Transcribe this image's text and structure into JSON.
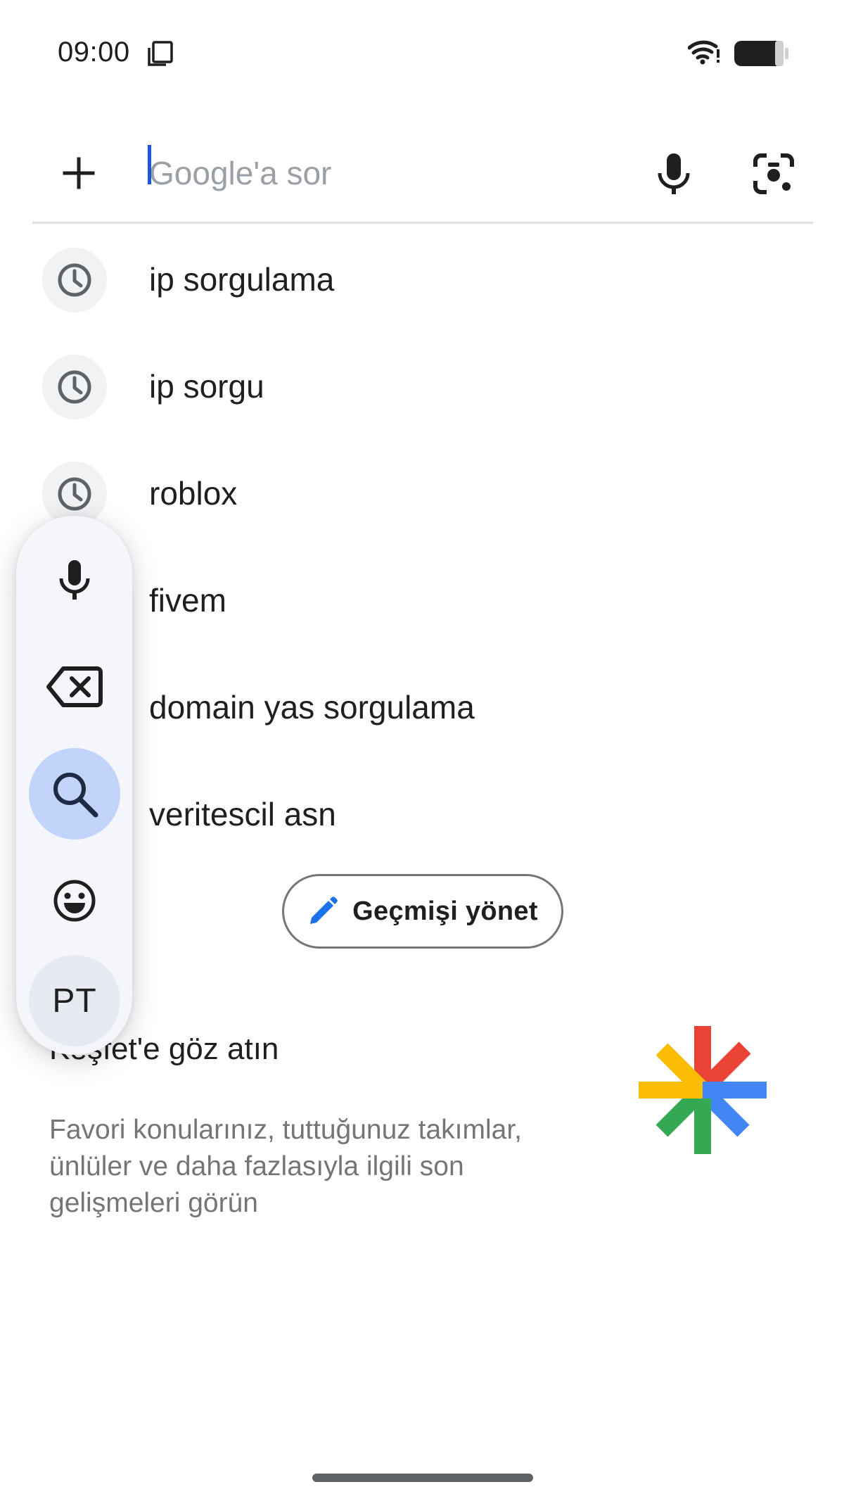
{
  "status_bar": {
    "time": "09:00",
    "icons": [
      "copy-icon",
      "wifi-icon",
      "battery-icon"
    ]
  },
  "search": {
    "placeholder": "Google'a sor",
    "value": "",
    "icons": [
      "plus-icon",
      "mic-icon",
      "lens-icon"
    ]
  },
  "suggestions": [
    {
      "text": "ip sorgulama",
      "icon": "history-icon"
    },
    {
      "text": "ip sorgu",
      "icon": "history-icon"
    },
    {
      "text": "roblox",
      "icon": "history-icon"
    },
    {
      "text": "fivem",
      "icon": "history-icon"
    },
    {
      "text": "domain yas sorgulama",
      "icon": "history-icon"
    },
    {
      "text": "veritescil asn",
      "icon": "history-icon"
    }
  ],
  "manage_history": {
    "label": "Geçmişi yönet",
    "icon": "pencil-icon"
  },
  "discover": {
    "title": "Keşfet'e göz atın",
    "description": "Favori konularınız, tuttuğunuz takımlar, ünlüler ve daha fazlasıyla ilgili son gelişmeleri görün",
    "logo": "discover-logo-icon"
  },
  "keyboard_toolbar": {
    "items": [
      {
        "name": "voice",
        "icon": "mic-icon"
      },
      {
        "name": "delete",
        "icon": "backspace-icon"
      },
      {
        "name": "search",
        "icon": "search-icon",
        "active": true
      },
      {
        "name": "emoji",
        "icon": "emoji-icon"
      },
      {
        "name": "language",
        "label": "PT"
      }
    ]
  },
  "colors": {
    "accent": "#1a57d4",
    "pencil": "#1a73e8",
    "active_bg": "#c3d4fb",
    "logo_red": "#ea4335",
    "logo_blue": "#4285f4",
    "logo_green": "#34a853",
    "logo_yellow": "#fbbc04"
  }
}
